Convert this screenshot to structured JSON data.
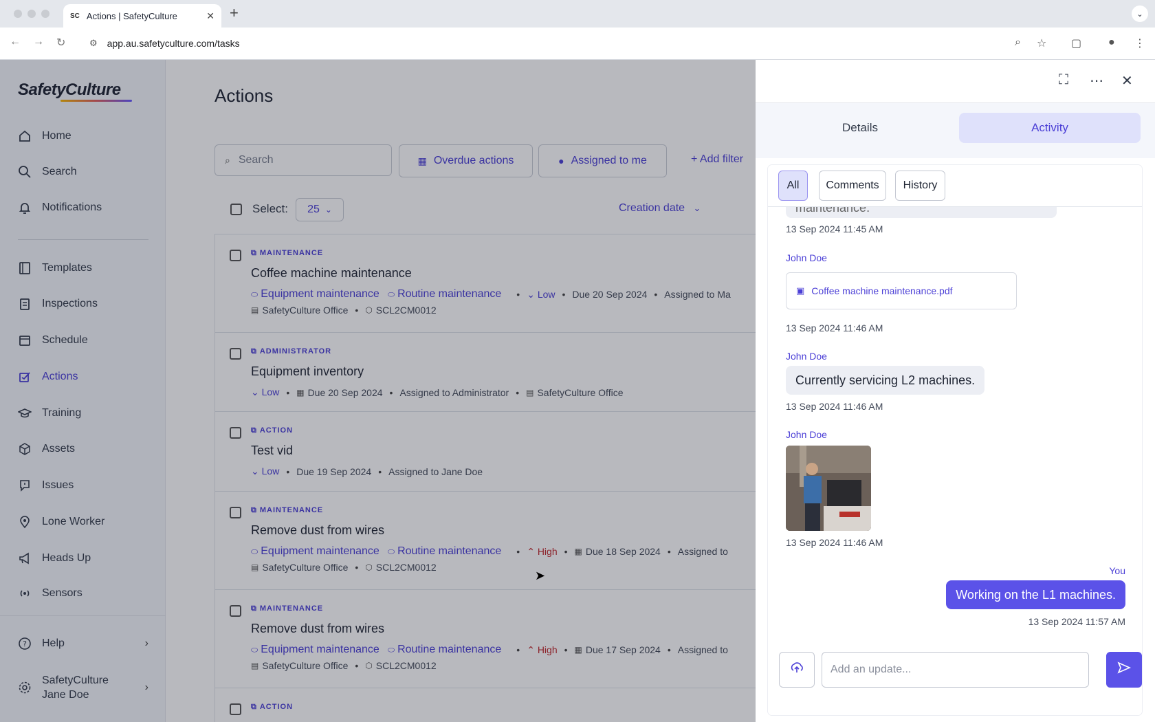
{
  "browser": {
    "tab_title": "Actions | SafetyCulture",
    "tab_favicon": "SC",
    "url": "app.au.safetyculture.com/tasks"
  },
  "sidebar": {
    "logo": "SafetyCulture",
    "items": [
      {
        "label": "Home",
        "icon": "home-icon"
      },
      {
        "label": "Search",
        "icon": "search-icon"
      },
      {
        "label": "Notifications",
        "icon": "bell-icon"
      },
      {
        "label": "Templates",
        "icon": "template-icon"
      },
      {
        "label": "Inspections",
        "icon": "clipboard-icon"
      },
      {
        "label": "Schedule",
        "icon": "calendar-icon"
      },
      {
        "label": "Actions",
        "icon": "actions-icon"
      },
      {
        "label": "Training",
        "icon": "graduation-icon"
      },
      {
        "label": "Assets",
        "icon": "cube-icon"
      },
      {
        "label": "Issues",
        "icon": "alert-icon"
      },
      {
        "label": "Lone Worker",
        "icon": "map-pin-icon"
      },
      {
        "label": "Heads Up",
        "icon": "megaphone-icon"
      },
      {
        "label": "Sensors",
        "icon": "sensor-icon"
      }
    ],
    "help": "Help",
    "org_name": "SafetyCulture",
    "user_name": "Jane Doe"
  },
  "main": {
    "title": "Actions",
    "search_placeholder": "Search",
    "filter_overdue": "Overdue actions",
    "filter_assigned": "Assigned to me",
    "add_filter": "+ Add filter",
    "select_label": "Select:",
    "page_size": "25",
    "sort_label": "Creation date",
    "rows": [
      {
        "category": "MAINTENANCE",
        "title": "Coffee machine maintenance",
        "label1": "Equipment maintenance",
        "label2": "Routine maintenance",
        "priority": "Low",
        "due": "Due 20 Sep 2024",
        "assigned": "Assigned to Ma",
        "site": "SafetyCulture Office",
        "asset": "SCL2CM0012"
      },
      {
        "category": "ADMINISTRATOR",
        "title": "Equipment inventory",
        "priority": "Low",
        "due": "Due 20 Sep 2024",
        "assigned": "Assigned to Administrator",
        "site": "SafetyCulture Office"
      },
      {
        "category": "ACTION",
        "title": "Test vid",
        "priority": "Low",
        "due": "Due 19 Sep 2024",
        "assigned": "Assigned to Jane Doe"
      },
      {
        "category": "MAINTENANCE",
        "title": "Remove dust from wires",
        "label1": "Equipment maintenance",
        "label2": "Routine maintenance",
        "priority": "High",
        "due": "Due 18 Sep 2024",
        "assigned": "Assigned to",
        "site": "SafetyCulture Office",
        "asset": "SCL2CM0012"
      },
      {
        "category": "MAINTENANCE",
        "title": "Remove dust from wires",
        "label1": "Equipment maintenance",
        "label2": "Routine maintenance",
        "priority": "High",
        "due": "Due 17 Sep 2024",
        "assigned": "Assigned to",
        "site": "SafetyCulture Office",
        "asset": "SCL2CM0012"
      },
      {
        "category": "ACTION"
      }
    ]
  },
  "panel": {
    "tabs": [
      "Details",
      "Activity"
    ],
    "active_tab": "Activity",
    "filter_chips": [
      "All",
      "Comments",
      "History"
    ],
    "feed": {
      "partial_text": "maintenance.",
      "ts1": "13 Sep 2024 11:45 AM",
      "author2": "John Doe",
      "attachment": "Coffee machine maintenance.pdf",
      "ts2": "13 Sep 2024 11:46 AM",
      "author3": "John Doe",
      "message3": "Currently servicing L2 machines.",
      "ts3": "13 Sep 2024 11:46 AM",
      "author4": "John Doe",
      "ts4": "13 Sep 2024 11:46 AM",
      "me_label": "You",
      "me_message": "Working on the L1 machines.",
      "me_ts": "13 Sep 2024 11:57 AM"
    },
    "compose_placeholder": "Add an update..."
  },
  "colors": {
    "accent": "#4b3fd6",
    "accent_fill": "#5b52e8",
    "high_priority": "#c0282c",
    "active_tab_bg": "#dfe1fb"
  }
}
